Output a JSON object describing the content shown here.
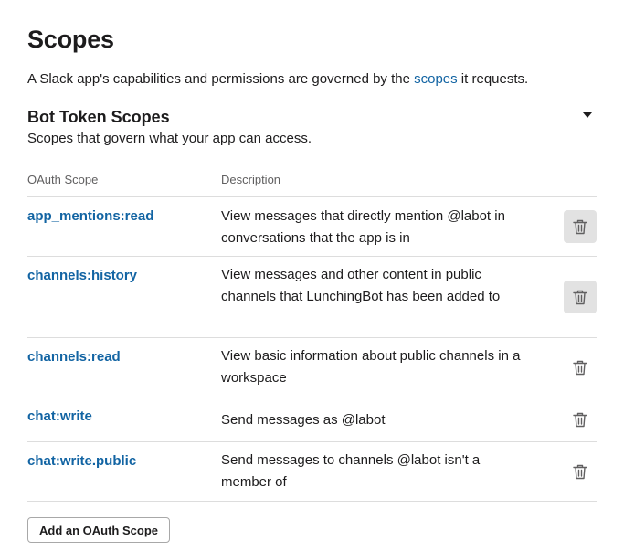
{
  "page": {
    "title": "Scopes",
    "intro_before": "A Slack app's capabilities and permissions are governed by the ",
    "intro_link": "scopes",
    "intro_after": " it requests."
  },
  "section": {
    "title": "Bot Token Scopes",
    "subtitle": "Scopes that govern what your app can access.",
    "toggle_icon": "caret-down-icon"
  },
  "table": {
    "headers": {
      "scope": "OAuth Scope",
      "description": "Description"
    },
    "rows": [
      {
        "scope": "app_mentions:read",
        "description": "View messages that directly mention @labot in conversations that the app is in"
      },
      {
        "scope": "channels:history",
        "description": "View messages and other content in public channels that LunchingBot has been added to"
      },
      {
        "scope": "channels:read",
        "description": "View basic information about public channels in a workspace"
      },
      {
        "scope": "chat:write",
        "description": "Send messages as @labot"
      },
      {
        "scope": "chat:write.public",
        "description": "Send messages to channels @labot isn't a member of"
      }
    ],
    "delete_icon": "trash-icon"
  },
  "actions": {
    "add_scope_label": "Add an OAuth Scope"
  },
  "colors": {
    "link": "#1264a3",
    "text": "#1d1c1d",
    "muted": "#616061",
    "divider": "#dddddd",
    "hover_bg": "#e2e2e2"
  }
}
